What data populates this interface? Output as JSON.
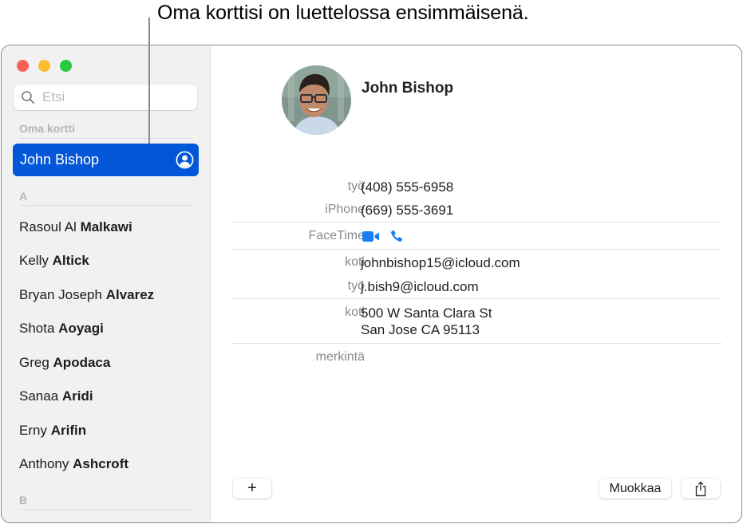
{
  "callout": {
    "text": "Oma korttisi on luettelossa ensimmäisenä."
  },
  "window": {
    "traffic_lights": {
      "close": "#fe5f57",
      "minimize": "#febc2e",
      "zoom": "#28c840"
    }
  },
  "sidebar": {
    "search": {
      "placeholder": "Etsi",
      "icon": "search-icon"
    },
    "my_card_header": "Oma kortti",
    "my_card": {
      "name": "John Bishop",
      "icon": "person-circle-icon",
      "selected_color": "#0256d8"
    },
    "sections": [
      {
        "letter": "A",
        "contacts": [
          {
            "first": "Rasoul Al",
            "last": "Malkawi"
          },
          {
            "first": "Kelly",
            "last": "Altick"
          },
          {
            "first": "Bryan Joseph",
            "last": "Alvarez"
          },
          {
            "first": "Shota",
            "last": "Aoyagi"
          },
          {
            "first": "Greg",
            "last": "Apodaca"
          },
          {
            "first": "Sanaa",
            "last": "Aridi"
          },
          {
            "first": "Erny",
            "last": "Arifin"
          },
          {
            "first": "Anthony",
            "last": "Ashcroft"
          }
        ]
      },
      {
        "letter": "B",
        "contacts": []
      }
    ]
  },
  "card": {
    "name": "John Bishop",
    "avatar": "contact-photo",
    "fields": {
      "phone_work_label": "työ",
      "phone_work": "(408) 555-6958",
      "phone_iphone_label": "iPhone",
      "phone_iphone": "(669) 555-3691",
      "facetime_label": "FaceTime",
      "facetime_video_icon": "video-camera-icon",
      "facetime_audio_icon": "phone-icon",
      "email_home_label": "koti",
      "email_home": "johnbishop15@icloud.com",
      "email_work_label": "työ",
      "email_work": "j.bish9@icloud.com",
      "address_home_label": "koti",
      "address_line1": "500 W Santa Clara St",
      "address_line2": "San Jose CA 95113",
      "note_label": "merkintä"
    },
    "accent_color": "#1a7cf5"
  },
  "toolbar": {
    "add_label": "+",
    "edit_label": "Muokkaa",
    "share_icon": "share-icon"
  }
}
